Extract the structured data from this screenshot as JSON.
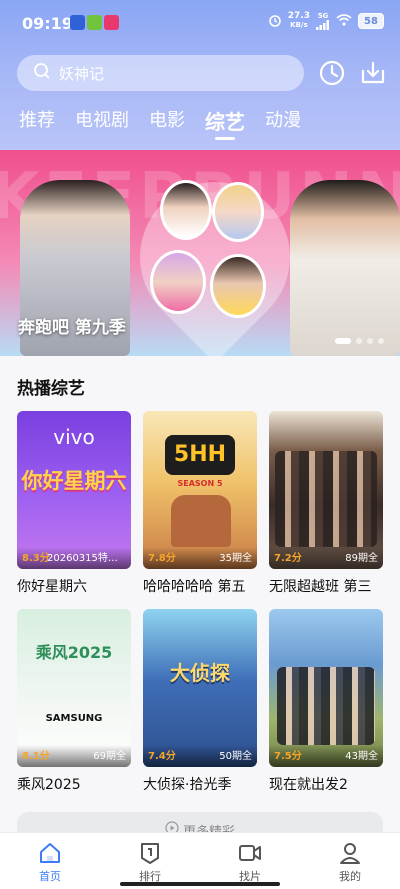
{
  "status_bar": {
    "time": "09:19",
    "net_speed": "27.3",
    "net_unit": "KB/s",
    "signal_label": "5G",
    "battery": "58"
  },
  "search": {
    "placeholder": "妖神记"
  },
  "tabs": [
    {
      "label": "推荐",
      "active": false
    },
    {
      "label": "电视剧",
      "active": false
    },
    {
      "label": "电影",
      "active": false
    },
    {
      "label": "综艺",
      "active": true
    },
    {
      "label": "动漫",
      "active": false
    }
  ],
  "banner": {
    "title": "奔跑吧 第九季",
    "deco_text": "KEEPRUNNIN",
    "page_count": 4,
    "active_index": 0
  },
  "section": {
    "title": "热播综艺"
  },
  "shows": [
    {
      "title": "你好星期六",
      "score": "8.3分",
      "extra": "20260315特…",
      "episodes": "",
      "poster_text": "你好星期六",
      "brand": "vivo",
      "colors": [
        "#7a3fe0",
        "#c779f0"
      ]
    },
    {
      "title": "哈哈哈哈哈 第五",
      "score": "7.8分",
      "extra": "",
      "episodes": "35期全",
      "poster_text": "5HH",
      "brand": "SEASON 5",
      "colors": [
        "#f5c46a",
        "#d98b44"
      ]
    },
    {
      "title": "无限超越班 第三",
      "score": "7.2分",
      "extra": "",
      "episodes": "89期全",
      "poster_text": "",
      "brand": "",
      "colors": [
        "#3a2c28",
        "#6e5a4c"
      ]
    },
    {
      "title": "乘风2025",
      "score": "8.1分",
      "extra": "",
      "episodes": "69期全",
      "poster_text": "乘风2025",
      "brand": "SAMSUNG",
      "colors": [
        "#eaf4ec",
        "#b9e3c4"
      ]
    },
    {
      "title": "大侦探·拾光季",
      "score": "7.4分",
      "extra": "",
      "episodes": "50期全",
      "poster_text": "大侦探",
      "brand": "",
      "colors": [
        "#3f6fb8",
        "#7cc0e6"
      ]
    },
    {
      "title": "现在就出发2",
      "score": "7.5分",
      "extra": "",
      "episodes": "43期全",
      "poster_text": "",
      "brand": "",
      "colors": [
        "#4f7ab0",
        "#9fb56a"
      ]
    }
  ],
  "more_button": {
    "label": "更多精彩"
  },
  "bottom_nav": [
    {
      "label": "首页",
      "icon": "home-icon",
      "active": true
    },
    {
      "label": "排行",
      "icon": "rank-icon",
      "active": false
    },
    {
      "label": "找片",
      "icon": "video-icon",
      "active": false
    },
    {
      "label": "我的",
      "icon": "profile-icon",
      "active": false
    }
  ],
  "colors": {
    "accent": "#3f7cf3",
    "score": "#f4a52a"
  }
}
